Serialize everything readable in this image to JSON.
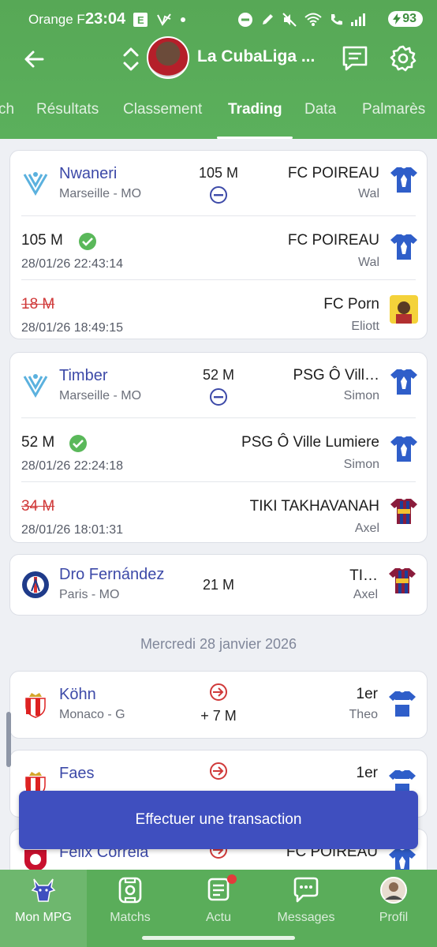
{
  "status_bar": {
    "carrier": "Orange F",
    "time": "23:04",
    "battery": "93"
  },
  "header": {
    "league_title": "La CubaLiga ..."
  },
  "tabs": [
    {
      "label": "ch"
    },
    {
      "label": "Résultats"
    },
    {
      "label": "Classement"
    },
    {
      "label": "Trading",
      "active": true
    },
    {
      "label": "Data"
    },
    {
      "label": "Palmarès"
    }
  ],
  "trades": [
    {
      "player": "Nwaneri",
      "club": "Marseille - MO",
      "price": "105 M",
      "team": "FC POIREAU",
      "owner": "Wal",
      "bids": [
        {
          "amount": "105 M",
          "date": "28/01/26 22:43:14",
          "team": "FC POIREAU",
          "owner": "Wal",
          "won": true
        },
        {
          "amount": "18 M",
          "date": "28/01/26 18:49:15",
          "team": "FC Porn",
          "owner": "Eliott",
          "won": false
        }
      ]
    },
    {
      "player": "Timber",
      "club": "Marseille - MO",
      "price": "52 M",
      "team": "PSG Ô Vill…",
      "owner": "Simon",
      "bids": [
        {
          "amount": "52 M",
          "date": "28/01/26 22:24:18",
          "team": "PSG Ô Ville Lumiere",
          "owner": "Simon",
          "won": true
        },
        {
          "amount": "34 M",
          "date": "28/01/26 18:01:31",
          "team": "TIKI TAKHAVANAH",
          "owner": "Axel",
          "won": false
        }
      ]
    },
    {
      "player": "Dro Fernández",
      "club": "Paris - MO",
      "price": "21 M",
      "team": "TI…",
      "owner": "Axel"
    }
  ],
  "date_header": "Mercredi 28 janvier 2026",
  "transfers": [
    {
      "player": "Köhn",
      "club": "Monaco - G",
      "delta": "+ 7 M",
      "rank": "1er",
      "owner": "Theo"
    },
    {
      "player": "Faes",
      "rank": "1er"
    },
    {
      "player": "Felix Correia",
      "team": "FC POIREAU"
    }
  ],
  "cta_label": "Effectuer une transaction",
  "bottom_nav": [
    {
      "label": "Mon MPG",
      "icon": "goat-icon",
      "active": true
    },
    {
      "label": "Matchs",
      "icon": "match-icon"
    },
    {
      "label": "Actu",
      "icon": "news-icon"
    },
    {
      "label": "Messages",
      "icon": "chat-bubble-icon"
    },
    {
      "label": "Profil",
      "icon": "profile-avatar"
    }
  ],
  "colors": {
    "header_green": "#5bb05c",
    "accent_blue": "#3f4fbf",
    "player_link": "#3d4aa8",
    "lost_red": "#d03939",
    "won_green": "#5ab85a"
  }
}
